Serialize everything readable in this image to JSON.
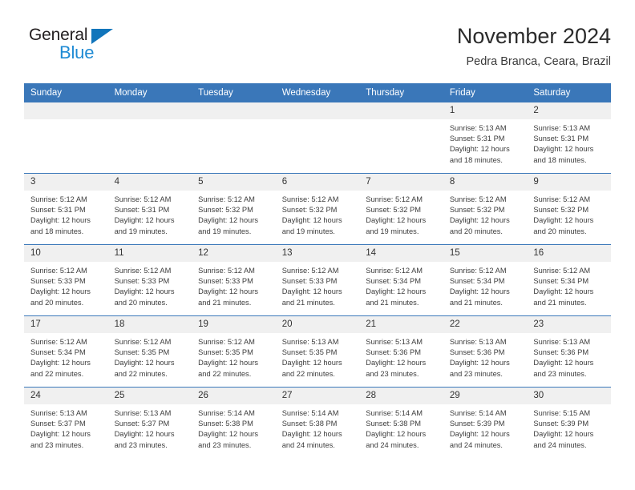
{
  "logo": {
    "word1": "General",
    "word2": "Blue",
    "triangle_color": "#1175bb",
    "word2_color": "#1f8bd4"
  },
  "header": {
    "title": "November 2024",
    "subtitle": "Pedra Branca, Ceara, Brazil"
  },
  "theme": {
    "header_blue": "#3a77b9",
    "day_strip_gray": "#f0f0f0"
  },
  "calendar": {
    "weekday_headers": [
      "Sunday",
      "Monday",
      "Tuesday",
      "Wednesday",
      "Thursday",
      "Friday",
      "Saturday"
    ],
    "weeks": [
      [
        {
          "day": "",
          "empty": true
        },
        {
          "day": "",
          "empty": true
        },
        {
          "day": "",
          "empty": true
        },
        {
          "day": "",
          "empty": true
        },
        {
          "day": "",
          "empty": true
        },
        {
          "day": "1",
          "sunrise": "Sunrise: 5:13 AM",
          "sunset": "Sunset: 5:31 PM",
          "daylight": "Daylight: 12 hours and 18 minutes."
        },
        {
          "day": "2",
          "sunrise": "Sunrise: 5:13 AM",
          "sunset": "Sunset: 5:31 PM",
          "daylight": "Daylight: 12 hours and 18 minutes."
        }
      ],
      [
        {
          "day": "3",
          "sunrise": "Sunrise: 5:12 AM",
          "sunset": "Sunset: 5:31 PM",
          "daylight": "Daylight: 12 hours and 18 minutes."
        },
        {
          "day": "4",
          "sunrise": "Sunrise: 5:12 AM",
          "sunset": "Sunset: 5:31 PM",
          "daylight": "Daylight: 12 hours and 19 minutes."
        },
        {
          "day": "5",
          "sunrise": "Sunrise: 5:12 AM",
          "sunset": "Sunset: 5:32 PM",
          "daylight": "Daylight: 12 hours and 19 minutes."
        },
        {
          "day": "6",
          "sunrise": "Sunrise: 5:12 AM",
          "sunset": "Sunset: 5:32 PM",
          "daylight": "Daylight: 12 hours and 19 minutes."
        },
        {
          "day": "7",
          "sunrise": "Sunrise: 5:12 AM",
          "sunset": "Sunset: 5:32 PM",
          "daylight": "Daylight: 12 hours and 19 minutes."
        },
        {
          "day": "8",
          "sunrise": "Sunrise: 5:12 AM",
          "sunset": "Sunset: 5:32 PM",
          "daylight": "Daylight: 12 hours and 20 minutes."
        },
        {
          "day": "9",
          "sunrise": "Sunrise: 5:12 AM",
          "sunset": "Sunset: 5:32 PM",
          "daylight": "Daylight: 12 hours and 20 minutes."
        }
      ],
      [
        {
          "day": "10",
          "sunrise": "Sunrise: 5:12 AM",
          "sunset": "Sunset: 5:33 PM",
          "daylight": "Daylight: 12 hours and 20 minutes."
        },
        {
          "day": "11",
          "sunrise": "Sunrise: 5:12 AM",
          "sunset": "Sunset: 5:33 PM",
          "daylight": "Daylight: 12 hours and 20 minutes."
        },
        {
          "day": "12",
          "sunrise": "Sunrise: 5:12 AM",
          "sunset": "Sunset: 5:33 PM",
          "daylight": "Daylight: 12 hours and 21 minutes."
        },
        {
          "day": "13",
          "sunrise": "Sunrise: 5:12 AM",
          "sunset": "Sunset: 5:33 PM",
          "daylight": "Daylight: 12 hours and 21 minutes."
        },
        {
          "day": "14",
          "sunrise": "Sunrise: 5:12 AM",
          "sunset": "Sunset: 5:34 PM",
          "daylight": "Daylight: 12 hours and 21 minutes."
        },
        {
          "day": "15",
          "sunrise": "Sunrise: 5:12 AM",
          "sunset": "Sunset: 5:34 PM",
          "daylight": "Daylight: 12 hours and 21 minutes."
        },
        {
          "day": "16",
          "sunrise": "Sunrise: 5:12 AM",
          "sunset": "Sunset: 5:34 PM",
          "daylight": "Daylight: 12 hours and 21 minutes."
        }
      ],
      [
        {
          "day": "17",
          "sunrise": "Sunrise: 5:12 AM",
          "sunset": "Sunset: 5:34 PM",
          "daylight": "Daylight: 12 hours and 22 minutes."
        },
        {
          "day": "18",
          "sunrise": "Sunrise: 5:12 AM",
          "sunset": "Sunset: 5:35 PM",
          "daylight": "Daylight: 12 hours and 22 minutes."
        },
        {
          "day": "19",
          "sunrise": "Sunrise: 5:12 AM",
          "sunset": "Sunset: 5:35 PM",
          "daylight": "Daylight: 12 hours and 22 minutes."
        },
        {
          "day": "20",
          "sunrise": "Sunrise: 5:13 AM",
          "sunset": "Sunset: 5:35 PM",
          "daylight": "Daylight: 12 hours and 22 minutes."
        },
        {
          "day": "21",
          "sunrise": "Sunrise: 5:13 AM",
          "sunset": "Sunset: 5:36 PM",
          "daylight": "Daylight: 12 hours and 23 minutes."
        },
        {
          "day": "22",
          "sunrise": "Sunrise: 5:13 AM",
          "sunset": "Sunset: 5:36 PM",
          "daylight": "Daylight: 12 hours and 23 minutes."
        },
        {
          "day": "23",
          "sunrise": "Sunrise: 5:13 AM",
          "sunset": "Sunset: 5:36 PM",
          "daylight": "Daylight: 12 hours and 23 minutes."
        }
      ],
      [
        {
          "day": "24",
          "sunrise": "Sunrise: 5:13 AM",
          "sunset": "Sunset: 5:37 PM",
          "daylight": "Daylight: 12 hours and 23 minutes."
        },
        {
          "day": "25",
          "sunrise": "Sunrise: 5:13 AM",
          "sunset": "Sunset: 5:37 PM",
          "daylight": "Daylight: 12 hours and 23 minutes."
        },
        {
          "day": "26",
          "sunrise": "Sunrise: 5:14 AM",
          "sunset": "Sunset: 5:38 PM",
          "daylight": "Daylight: 12 hours and 23 minutes."
        },
        {
          "day": "27",
          "sunrise": "Sunrise: 5:14 AM",
          "sunset": "Sunset: 5:38 PM",
          "daylight": "Daylight: 12 hours and 24 minutes."
        },
        {
          "day": "28",
          "sunrise": "Sunrise: 5:14 AM",
          "sunset": "Sunset: 5:38 PM",
          "daylight": "Daylight: 12 hours and 24 minutes."
        },
        {
          "day": "29",
          "sunrise": "Sunrise: 5:14 AM",
          "sunset": "Sunset: 5:39 PM",
          "daylight": "Daylight: 12 hours and 24 minutes."
        },
        {
          "day": "30",
          "sunrise": "Sunrise: 5:15 AM",
          "sunset": "Sunset: 5:39 PM",
          "daylight": "Daylight: 12 hours and 24 minutes."
        }
      ]
    ]
  }
}
